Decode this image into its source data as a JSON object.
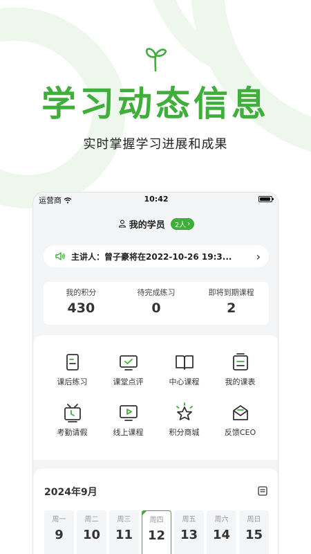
{
  "hero": {
    "title": "学习动态信息",
    "subtitle": "实时掌握学习进展和成果",
    "icon": "sprout-icon"
  },
  "status_bar": {
    "carrier": "运营商",
    "time": "10:42"
  },
  "header": {
    "title": "我的学员",
    "badge": "2人"
  },
  "notice": {
    "text": "主讲人：曾子豪将在2022-10-26 19:3..."
  },
  "stats": [
    {
      "label": "我的积分",
      "value": "430"
    },
    {
      "label": "待完成练习",
      "value": "0"
    },
    {
      "label": "即将到期课程",
      "value": "2"
    }
  ],
  "grid": [
    {
      "label": "课后练习",
      "icon": "homework-icon"
    },
    {
      "label": "课堂点评",
      "icon": "class-review-icon"
    },
    {
      "label": "中心课程",
      "icon": "book-icon"
    },
    {
      "label": "我的课表",
      "icon": "schedule-icon"
    },
    {
      "label": "考勤请假",
      "icon": "attendance-icon"
    },
    {
      "label": "线上课程",
      "icon": "online-course-icon"
    },
    {
      "label": "积分商城",
      "icon": "points-mall-icon"
    },
    {
      "label": "反馈CEO",
      "icon": "feedback-icon"
    }
  ],
  "calendar": {
    "title": "2024年9月",
    "days": [
      {
        "name": "周一",
        "num": "9"
      },
      {
        "name": "周二",
        "num": "10"
      },
      {
        "name": "周三",
        "num": "11"
      },
      {
        "name": "周四",
        "num": "12",
        "active": true
      },
      {
        "name": "周五",
        "num": "13"
      },
      {
        "name": "周六",
        "num": "14"
      },
      {
        "name": "周日",
        "num": "15"
      }
    ]
  },
  "colors": {
    "accent": "#3fae3a",
    "background_deco": "#eef7ec"
  }
}
